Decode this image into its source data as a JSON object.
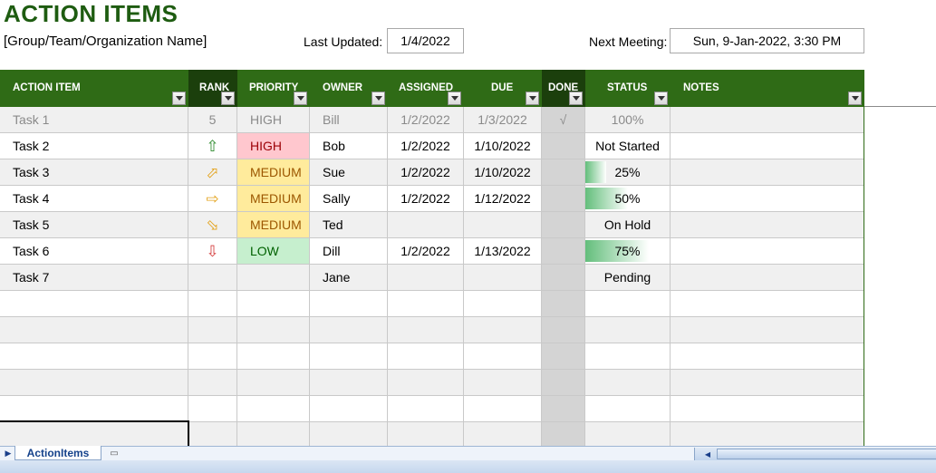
{
  "header": {
    "title": "ACTION ITEMS",
    "org_name": "[Group/Team/Organization Name]",
    "last_updated_label": "Last Updated:",
    "last_updated_value": "1/4/2022",
    "next_meeting_label": "Next Meeting:",
    "next_meeting_value": "Sun, 9-Jan-2022, 3:30 PM"
  },
  "columns": [
    "ACTION ITEM",
    "RANK",
    "PRIORITY",
    "OWNER",
    "ASSIGNED",
    "DUE",
    "DONE",
    "STATUS",
    "NOTES"
  ],
  "rows": [
    {
      "item": "Task 1",
      "rank": "5",
      "rank_icon": "",
      "priority": "HIGH",
      "owner": "Bill",
      "assigned": "1/2/2022",
      "due": "1/3/2022",
      "done": "√",
      "status": "100%",
      "progress": 1.0,
      "completed": true,
      "notes": ""
    },
    {
      "item": "Task 2",
      "rank": "",
      "rank_icon": "arrow-up-icon",
      "priority": "HIGH",
      "owner": "Bob",
      "assigned": "1/2/2022",
      "due": "1/10/2022",
      "done": "",
      "status": "Not Started",
      "progress": null,
      "completed": false,
      "notes": ""
    },
    {
      "item": "Task 3",
      "rank": "",
      "rank_icon": "arrow-up-right-icon",
      "priority": "MEDIUM",
      "owner": "Sue",
      "assigned": "1/2/2022",
      "due": "1/10/2022",
      "done": "",
      "status": "25%",
      "progress": 0.25,
      "completed": false,
      "notes": ""
    },
    {
      "item": "Task 4",
      "rank": "",
      "rank_icon": "arrow-right-icon",
      "priority": "MEDIUM",
      "owner": "Sally",
      "assigned": "1/2/2022",
      "due": "1/12/2022",
      "done": "",
      "status": "50%",
      "progress": 0.5,
      "completed": false,
      "notes": ""
    },
    {
      "item": "Task 5",
      "rank": "",
      "rank_icon": "arrow-down-right-icon",
      "priority": "MEDIUM",
      "owner": "Ted",
      "assigned": "",
      "due": "",
      "done": "",
      "status": "On Hold",
      "progress": null,
      "completed": false,
      "notes": ""
    },
    {
      "item": "Task 6",
      "rank": "",
      "rank_icon": "arrow-down-icon",
      "priority": "LOW",
      "owner": "Dill",
      "assigned": "1/2/2022",
      "due": "1/13/2022",
      "done": "",
      "status": "75%",
      "progress": 0.75,
      "completed": false,
      "notes": ""
    },
    {
      "item": "Task 7",
      "rank": "",
      "rank_icon": "",
      "priority": "",
      "owner": "Jane",
      "assigned": "",
      "due": "",
      "done": "",
      "status": "Pending",
      "progress": null,
      "completed": false,
      "notes": ""
    }
  ],
  "empty_rows": 6,
  "sheet_tab": "ActionItems",
  "colors": {
    "title_green": "#1e5c11",
    "header_green": "#2f6b16",
    "header_dark": "#1b3f0c",
    "high_bg": "#ffc7ce",
    "medium_bg": "#ffeb9c",
    "low_bg": "#c6efce",
    "databar": "#63be7b"
  }
}
